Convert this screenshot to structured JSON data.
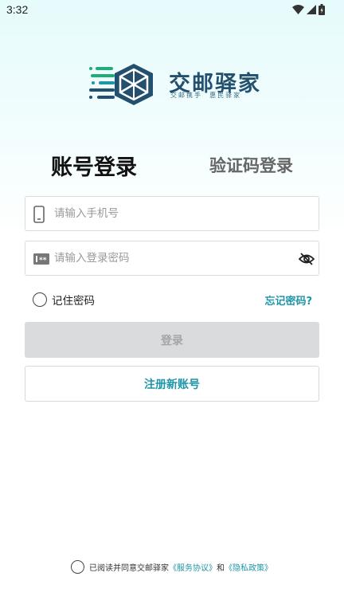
{
  "status_bar": {
    "time": "3:32"
  },
  "logo": {
    "title": "交邮驿家",
    "slogan": "交邮携手  惠民驿家"
  },
  "tabs": {
    "account": "账号登录",
    "code": "验证码登录"
  },
  "phone_field": {
    "placeholder": "请输入手机号"
  },
  "password_field": {
    "placeholder": "请输入登录密码"
  },
  "remember": {
    "label": "记住密码"
  },
  "forgot": {
    "label": "忘记密码?"
  },
  "login_button": {
    "label": "登录"
  },
  "register_button": {
    "label": "注册新账号"
  },
  "agreement": {
    "prefix": "已阅读并同意交邮驿家",
    "service_link": "《服务协议》",
    "and": "和",
    "privacy_link": "《隐私政策》"
  },
  "colors": {
    "accent": "#1f96a8",
    "logo_dark": "#24506f",
    "logo_green": "#1fae7a"
  }
}
